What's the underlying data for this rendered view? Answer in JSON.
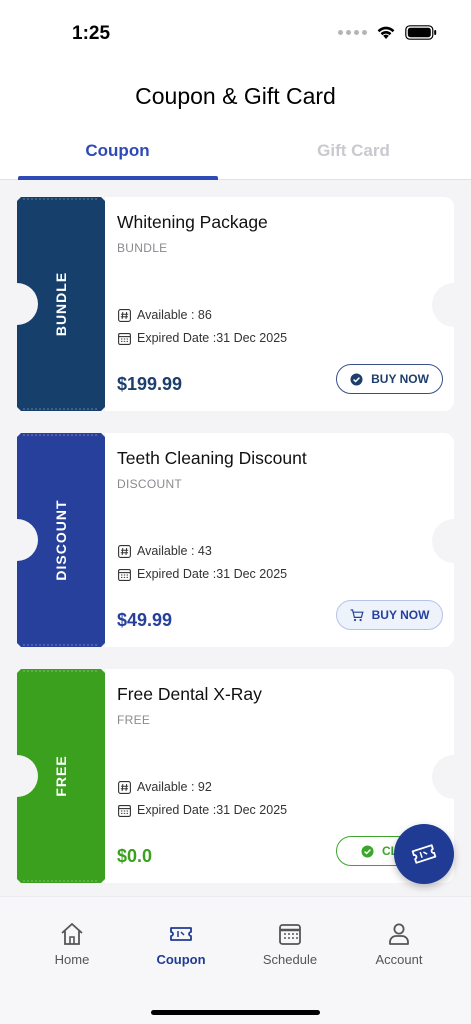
{
  "status": {
    "time": "1:25",
    "signal_icon": "signal-dots-icon",
    "wifi_icon": "wifi-icon",
    "battery_icon": "battery-icon"
  },
  "header": {
    "title": "Coupon & Gift Card"
  },
  "tabs": [
    {
      "label": "Coupon",
      "active": true
    },
    {
      "label": "Gift Card",
      "active": false
    }
  ],
  "coupons": [
    {
      "stub": "BUNDLE",
      "name": "Whitening Package",
      "tag": "BUNDLE",
      "available": "Available : 86",
      "expired": "Expired Date :31 Dec 2025",
      "price": "$199.99",
      "button": "BUY NOW",
      "color": "#173f6c",
      "price_color": "#1e3f6b"
    },
    {
      "stub": "DISCOUNT",
      "name": "Teeth Cleaning Discount",
      "tag": "DISCOUNT",
      "available": "Available : 43",
      "expired": "Expired Date :31 Dec 2025",
      "price": "$49.99",
      "button": "BUY NOW",
      "color": "#26409b",
      "price_color": "#26409b"
    },
    {
      "stub": "FREE",
      "name": "Free Dental X-Ray",
      "tag": "FREE",
      "available": "Available : 92",
      "expired": "Expired Date :31 Dec 2025",
      "price": "$0.0",
      "button": "CL",
      "color": "#3aa01e",
      "price_color": "#3aa01e"
    }
  ],
  "fab": {
    "icon": "ticket-icon"
  },
  "tabbar": [
    {
      "label": "Home",
      "icon": "home-icon",
      "active": false
    },
    {
      "label": "Coupon",
      "icon": "ticket-icon",
      "active": true
    },
    {
      "label": "Schedule",
      "icon": "calendar-icon",
      "active": false
    },
    {
      "label": "Account",
      "icon": "person-icon",
      "active": false
    }
  ]
}
